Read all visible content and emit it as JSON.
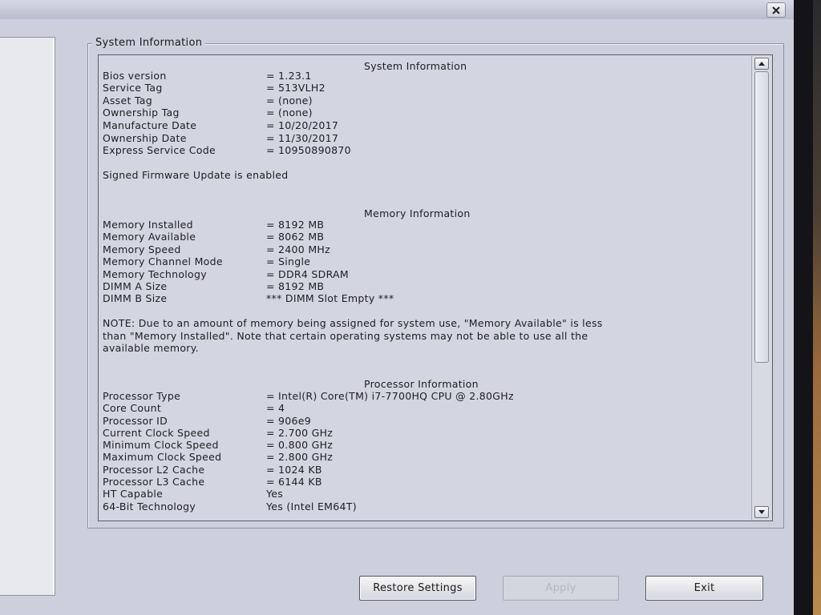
{
  "window": {
    "group_title": "System Information"
  },
  "sections": {
    "system": {
      "heading": "System Information",
      "rows": [
        {
          "label": "Bios version",
          "value": "= 1.23.1"
        },
        {
          "label": "Service Tag",
          "value": "= 513VLH2"
        },
        {
          "label": "Asset Tag",
          "value": "= (none)"
        },
        {
          "label": "Ownership Tag",
          "value": "= (none)"
        },
        {
          "label": "Manufacture Date",
          "value": "= 10/20/2017"
        },
        {
          "label": "Ownership Date",
          "value": "= 11/30/2017"
        },
        {
          "label": "Express Service Code",
          "value": "= 10950890870"
        }
      ],
      "firmware_note": "Signed Firmware Update is enabled"
    },
    "memory": {
      "heading": "Memory Information",
      "rows": [
        {
          "label": "Memory Installed",
          "value": "= 8192 MB"
        },
        {
          "label": "Memory Available",
          "value": "= 8062 MB"
        },
        {
          "label": "Memory Speed",
          "value": "= 2400 MHz"
        },
        {
          "label": "Memory Channel Mode",
          "value": "= Single"
        },
        {
          "label": "Memory Technology",
          "value": "= DDR4 SDRAM"
        },
        {
          "label": "DIMM A Size",
          "value": "= 8192 MB"
        },
        {
          "label": "DIMM B Size",
          "value": "*** DIMM Slot Empty ***"
        }
      ],
      "note_line1": "NOTE: Due to an amount of memory being assigned for system use, \"Memory Available\" is less",
      "note_line2": "than \"Memory Installed\". Note that certain operating systems may not be able to use all the",
      "note_line3": "available memory."
    },
    "processor": {
      "heading": "Processor Information",
      "rows": [
        {
          "label": "Processor Type",
          "value": "= Intel(R) Core(TM) i7-7700HQ CPU @ 2.80GHz"
        },
        {
          "label": "Core Count",
          "value": "= 4"
        },
        {
          "label": "Processor ID",
          "value": "= 906e9"
        },
        {
          "label": "Current Clock Speed",
          "value": "= 2.700 GHz"
        },
        {
          "label": "Minimum Clock Speed",
          "value": "= 0.800 GHz"
        },
        {
          "label": "Maximum Clock Speed",
          "value": "= 2.800 GHz"
        },
        {
          "label": "Processor L2 Cache",
          "value": "= 1024 KB"
        },
        {
          "label": "Processor L3 Cache",
          "value": "= 6144 KB"
        },
        {
          "label": "HT Capable",
          "value": "Yes"
        },
        {
          "label": "64-Bit Technology",
          "value": "Yes (Intel EM64T)"
        }
      ]
    }
  },
  "buttons": {
    "restore": "Restore Settings",
    "apply": "Apply",
    "exit": "Exit"
  },
  "icons": {
    "close": "close-icon",
    "scroll_up": "scroll-up-arrow-icon",
    "scroll_down": "scroll-down-arrow-icon"
  }
}
